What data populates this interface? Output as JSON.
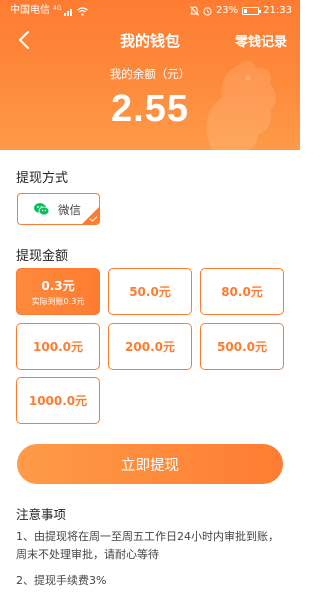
{
  "status_bar": {
    "carrier": "中国电信",
    "network_badge": "4G",
    "battery_percent": "23%",
    "battery_level": 0.23,
    "time": "21:33"
  },
  "nav": {
    "title": "我的钱包",
    "right_link": "零钱记录"
  },
  "balance": {
    "label": "我的余额（元）",
    "value": "2.55"
  },
  "withdraw_method": {
    "title": "提现方式",
    "option_label": "微信"
  },
  "withdraw_amount": {
    "title": "提现金额",
    "options": [
      {
        "label": "0.3元",
        "sublabel": "实际到账0.3元",
        "selected": true
      },
      {
        "label": "50.0元"
      },
      {
        "label": "80.0元"
      },
      {
        "label": "100.0元"
      },
      {
        "label": "200.0元"
      },
      {
        "label": "500.0元"
      },
      {
        "label": "1000.0元"
      }
    ]
  },
  "submit_label": "立即提现",
  "notes": {
    "title": "注意事项",
    "items": [
      "1、由提现将在周一至周五工作日24小时内审批到账，周末不处理审批，请耐心等待",
      "2、提现手续费3%"
    ]
  },
  "colors": {
    "accent": "#fe7c31",
    "wechat_green": "#07c160"
  }
}
